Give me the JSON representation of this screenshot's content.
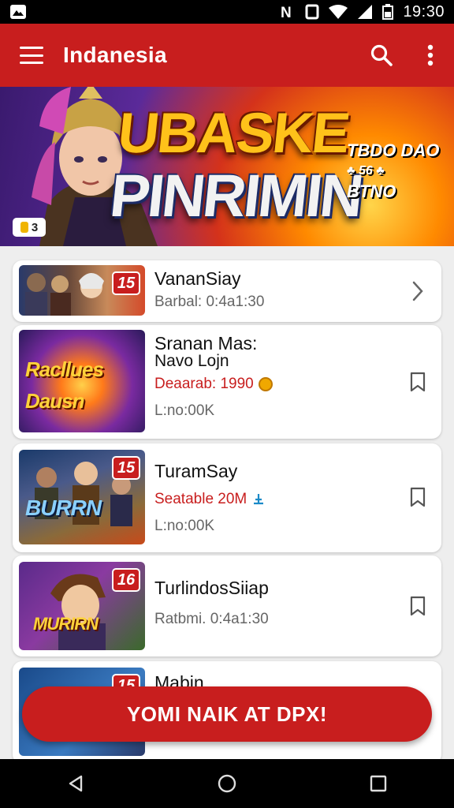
{
  "status_bar": {
    "time": "19:30"
  },
  "app_bar": {
    "title": "Indanesia"
  },
  "banner": {
    "title_line1": "UBASKE",
    "title_line2": "PINRIMIN",
    "side_text_line1": "TBDO DAO",
    "side_text_line2": "♣ 56  ♣",
    "side_text_line3": "BTNO",
    "badge": "3"
  },
  "cards": [
    {
      "title": "VananSiay",
      "meta": "Barbal: 0:4a1:30",
      "thumb_number": "15",
      "action": "chevron"
    },
    {
      "title": "Sranan Mas:",
      "subtitle": "Navo Lojn",
      "red_text": "Deaarab: 1990",
      "meta": "L:no:00K",
      "thumb_number": "",
      "thumb_text": "Racllues Dausn",
      "action": "bookmark"
    },
    {
      "title": "TuramSay",
      "red_text": "Seatable 20M",
      "meta": "L:no:00K",
      "thumb_number": "15",
      "thumb_text": "BURRN",
      "action": "bookmark"
    },
    {
      "title": "TurlindosSiiap",
      "meta": "Ratbmi. 0:4a1:30",
      "thumb_number": "16",
      "thumb_text": "MURIRN",
      "action": "bookmark"
    },
    {
      "title": "Mabin",
      "thumb_number": "15"
    }
  ],
  "cta": {
    "label": "YOMI NAIK AT DPX!"
  },
  "colors": {
    "primary": "#c81e1e",
    "background": "#eeeeee"
  }
}
